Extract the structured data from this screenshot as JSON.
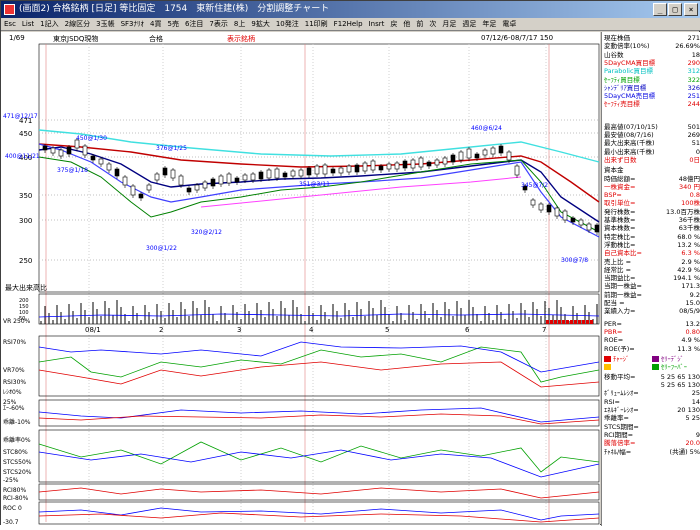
{
  "window": {
    "title": "(画面2) 合格銘柄 [日足] 等比固定　1754　東新住建(株)　分割調整チャート",
    "buttons": [
      "_",
      "□",
      "×"
    ]
  },
  "menu": [
    "Esc",
    "List",
    "1記入",
    "2線区分",
    "3玉帳",
    "SF3ﾅﾘｵ",
    "4買",
    "5売",
    "6注目",
    "7表示",
    "8上",
    "9拡大",
    "10発注",
    "11印刷",
    "F12Help",
    "Insrt",
    "戻",
    "他",
    "前",
    "次",
    "月足",
    "週足",
    "年足",
    "電卓"
  ],
  "header": {
    "page": "1/69",
    "market": "東京JSDQ現物",
    "status": "合格",
    "label": "表示銘柄",
    "range": "07/12/6-08/7/17 150"
  },
  "price_axis": [
    "471",
    "450",
    "400",
    "350",
    "300",
    "250"
  ],
  "annotations": [
    "471@12/17",
    "450@1/30",
    "400@11/21",
    "375@1/18",
    "376@1/25",
    "320@2/12",
    "300@1/22",
    "351@3/11",
    "460@6/24",
    "345@7/2",
    "300@7/8"
  ],
  "volume": {
    "title": "最大出来高比",
    "axis": [
      "200",
      "150",
      "100",
      "50"
    ],
    "label": "VR 250%"
  },
  "x_labels": [
    "08/1",
    "2",
    "3",
    "4",
    "5",
    "6",
    "7"
  ],
  "indicators": {
    "rsi": [
      "RSI70%",
      "VR70%",
      "RSI30%",
      "ﾚｼｵ0%",
      "25%"
    ],
    "ie": [
      "ｴｰ-60%",
      "乖離-10%"
    ],
    "kairi": [
      "乖離率0%",
      "STC80%",
      "STCS50%",
      "STCS20%",
      "-25%"
    ],
    "rci": [
      "RCI80%",
      "RCI-80%"
    ],
    "roc": [
      "ROC 0",
      "-30.7"
    ]
  },
  "side": {
    "stats": [
      {
        "label": "現在株価",
        "value": "271",
        "color": "#000000"
      },
      {
        "label": "変動倍率(10%)",
        "value": "26.69%",
        "color": "#000000"
      },
      {
        "label": "山谷数",
        "value": "18",
        "color": "#000000"
      },
      {
        "label": "5DayCMA買目標",
        "value": "290",
        "color": "#e00000"
      },
      {
        "label": "Parabolic買目標",
        "value": "312",
        "color": "#00c0c0"
      },
      {
        "label": "ｾｰﾌﾃｨ買目標",
        "value": "322",
        "color": "#00a000"
      },
      {
        "label": "ｼｬﾝﾃﾞﾘｱ買目標",
        "value": "326",
        "color": "#0000c0"
      },
      {
        "label": "5DayCMA売目標",
        "value": "251",
        "color": "#0000e0"
      },
      {
        "label": "ｾｰﾌﾃｨ売目標",
        "value": "244",
        "color": "#e00000"
      }
    ],
    "stats2": [
      {
        "label": "最高値(07/10/15)",
        "value": "501",
        "color": "#000000"
      },
      {
        "label": "最安値(08/7/16)",
        "value": "269",
        "color": "#000000"
      },
      {
        "label": "最大出来高(千株)",
        "value": "51",
        "color": "#000000"
      },
      {
        "label": "最小出来高(千株)",
        "value": "0",
        "color": "#000000"
      },
      {
        "label": "出来ず日数",
        "value": "0日",
        "color": "#e00000"
      }
    ],
    "fundamentals": [
      {
        "label": "資本金",
        "value": "",
        "color": "#000000"
      },
      {
        "label": "時価総額=",
        "value": "48億円",
        "color": "#000000"
      },
      {
        "label": "一株資金=",
        "value": "340 円",
        "color": "#e00000"
      },
      {
        "label": "BSP=",
        "value": "0.8",
        "color": "#e00000"
      },
      {
        "label": "取引単位=",
        "value": "100株",
        "color": "#e00000"
      },
      {
        "label": "発行株数=",
        "value": "13.0百万株",
        "color": "#000000"
      },
      {
        "label": "基準株数=",
        "value": "36千株",
        "color": "#000000"
      },
      {
        "label": "資本株数=",
        "value": "63千株",
        "color": "#000000"
      },
      {
        "label": "特定株比=",
        "value": "68.0 %",
        "color": "#000000"
      },
      {
        "label": "浮動株比=",
        "value": "13.2 %",
        "color": "#000000"
      },
      {
        "label": "自己資本比=",
        "value": "6.3 %",
        "color": "#e00000"
      },
      {
        "label": "売上比 =",
        "value": "2.9 %",
        "color": "#000000"
      },
      {
        "label": "経常比 =",
        "value": "42.9 %",
        "color": "#000000"
      },
      {
        "label": "当期益比=",
        "value": "194.1 %",
        "color": "#000000"
      },
      {
        "label": "当期一株益=",
        "value": "171.3",
        "color": "#000000"
      },
      {
        "label": "前期一株益=",
        "value": "9.2",
        "color": "#000000"
      },
      {
        "label": "配当 =",
        "value": "15.0",
        "color": "#000000"
      },
      {
        "label": "業績入力=",
        "value": "08/5/9",
        "color": "#000000"
      }
    ],
    "ratios": [
      {
        "label": "PER=",
        "value": "13.2",
        "color": "#000000"
      },
      {
        "label": "PBR=",
        "value": "0.80",
        "color": "#e00000"
      },
      {
        "label": "ROE=",
        "value": "4.9 %",
        "color": "#000000"
      },
      {
        "label": "ROE(予)=",
        "value": "11.3 %",
        "color": "#000000"
      }
    ],
    "legend": [
      {
        "label": "ﾁｬｰｼﾞ",
        "color": "#e00000"
      },
      {
        "label": "ｾﾘｰﾃﾞｼﾞ",
        "color": "#800080"
      },
      {
        "label": "",
        "color": "#ffc000"
      },
      {
        "label": "ｾﾘｰﾌｰﾊﾞｰ",
        "color": "#00a000"
      }
    ],
    "settings": [
      {
        "label": "移動平均=",
        "value": "5 25 65 130",
        "color": "#000000"
      },
      {
        "label": "",
        "value": "5 25 65 130",
        "color": "#000000"
      },
      {
        "label": "ﾎﾞﾘｭｰﾑﾚｼｵ=",
        "value": "25",
        "color": "#000000"
      },
      {
        "label": "RSI=",
        "value": "14",
        "color": "#000000"
      },
      {
        "label": "ｴﾈﾙｷﾞｰﾚｼｵ=",
        "value": "20 130",
        "color": "#000000"
      },
      {
        "label": "乖離率=",
        "value": "5 25",
        "color": "#000000"
      },
      {
        "label": "STCS期間=",
        "value": "",
        "color": "#000000"
      },
      {
        "label": "RCI期間=",
        "value": "9",
        "color": "#000000"
      },
      {
        "label": "騰落倍率=",
        "value": "20.0",
        "color": "#e00000"
      },
      {
        "label": "ﾁｬﾈﾙ/幅=",
        "value": "(共通) 5%",
        "color": "#000000"
      }
    ]
  }
}
